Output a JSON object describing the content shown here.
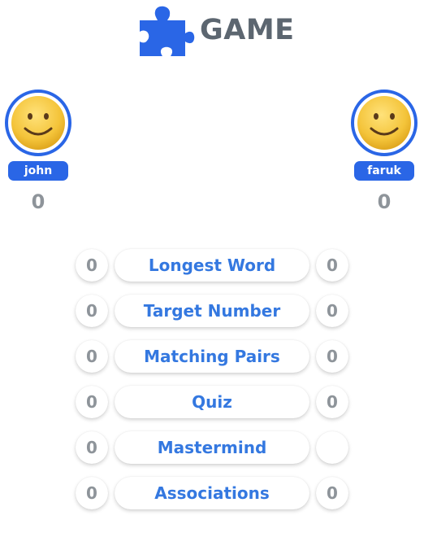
{
  "header": {
    "logo_text": "GAME",
    "logo_icon": "puzzle-piece-icon",
    "logo_color": "#2a66e6"
  },
  "players": {
    "left": {
      "name": "john",
      "score": "0",
      "avatar": "smiley-face-icon"
    },
    "right": {
      "name": "faruk",
      "score": "0",
      "avatar": "smiley-face-icon"
    }
  },
  "rounds": [
    {
      "label": "Longest Word",
      "left_score": "0",
      "right_score": "0"
    },
    {
      "label": "Target Number",
      "left_score": "0",
      "right_score": "0"
    },
    {
      "label": "Matching Pairs",
      "left_score": "0",
      "right_score": "0"
    },
    {
      "label": "Quiz",
      "left_score": "0",
      "right_score": "0"
    },
    {
      "label": "Mastermind",
      "left_score": "0",
      "right_score": ""
    },
    {
      "label": "Associations",
      "left_score": "0",
      "right_score": "0"
    }
  ],
  "colors": {
    "accent": "#2a66e6",
    "round_label": "#3478e0",
    "score_gray": "#8e949a",
    "logo_text": "#5c6670"
  }
}
